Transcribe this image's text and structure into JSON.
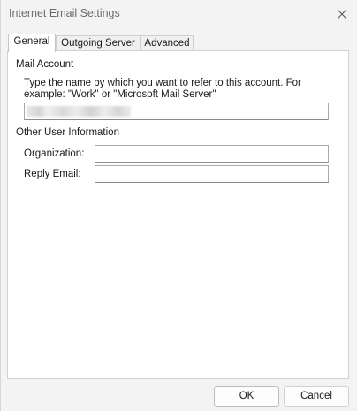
{
  "window": {
    "title": "Internet Email Settings"
  },
  "tabs": [
    {
      "label": "General",
      "active": true
    },
    {
      "label": "Outgoing Server",
      "active": false
    },
    {
      "label": "Advanced",
      "active": false
    }
  ],
  "mail_account": {
    "group_title": "Mail Account",
    "description": "Type the name by which you want to refer to this account. For example: \"Work\" or \"Microsoft Mail Server\"",
    "account_name_value": "[blurred]"
  },
  "other_user_info": {
    "group_title": "Other User Information",
    "organization_label": "Organization:",
    "organization_value": "",
    "reply_email_label": "Reply Email:",
    "reply_email_value": ""
  },
  "buttons": {
    "ok_label": "OK",
    "cancel_label": "Cancel"
  },
  "icons": {
    "close": "close-icon"
  }
}
